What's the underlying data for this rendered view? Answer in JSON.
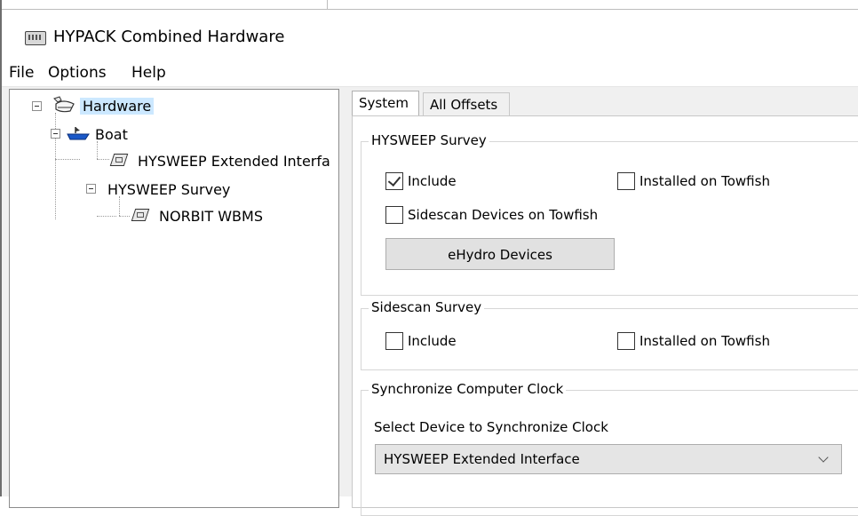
{
  "window": {
    "title": "HYPACK Combined Hardware",
    "icon": "hardware-app-icon"
  },
  "menu": [
    "File",
    "Options",
    "Help"
  ],
  "tree": {
    "root": "Hardware",
    "boat": "Boat",
    "boat_child": "HYSWEEP Extended Interfa",
    "survey": "HYSWEEP Survey",
    "survey_child": "NORBIT WBMS"
  },
  "tabs": [
    "System",
    "All Offsets"
  ],
  "hysweep_survey": {
    "title": "HYSWEEP Survey",
    "include_label": "Include",
    "include_checked": true,
    "towfish_label": "Installed on Towfish",
    "towfish_checked": false,
    "sidescan_towfish_label": "Sidescan Devices on Towfish",
    "sidescan_towfish_checked": false,
    "ehydro_button": "eHydro Devices"
  },
  "sidescan_survey": {
    "title": "Sidescan Survey",
    "include_label": "Include",
    "include_checked": false,
    "towfish_label": "Installed on Towfish",
    "towfish_checked": false
  },
  "clock": {
    "title": "Synchronize Computer Clock",
    "select_label": "Select Device to Synchronize Clock",
    "selected_device": "HYSWEEP Extended Interface"
  }
}
